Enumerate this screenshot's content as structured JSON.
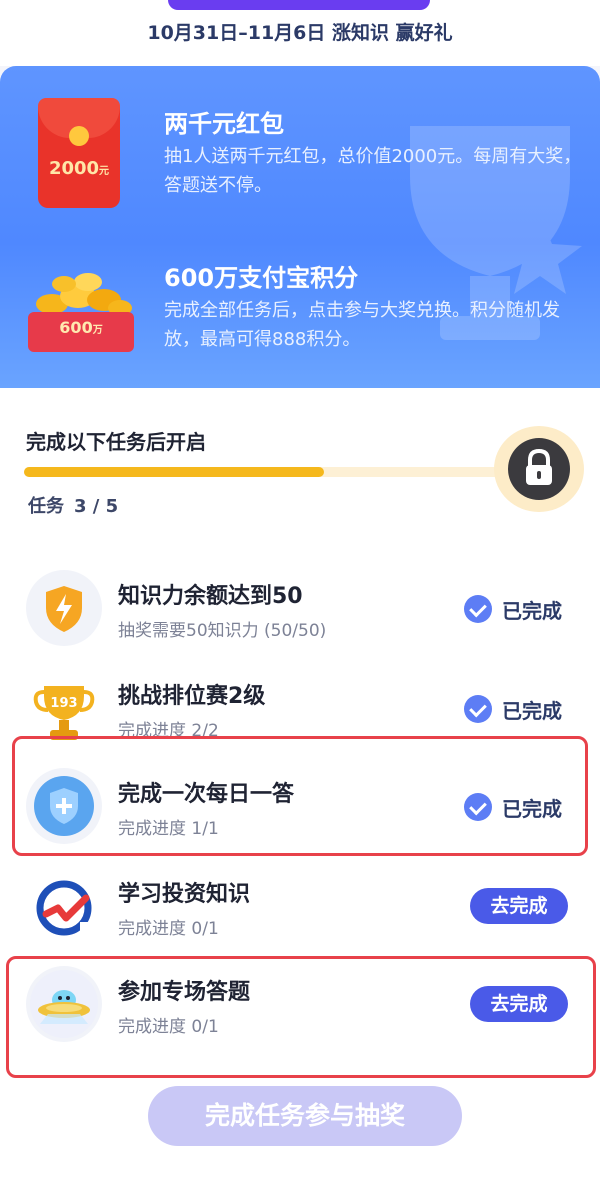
{
  "header": {
    "date_line": "10月31日–11月6日 涨知识 赢好礼"
  },
  "prizes": [
    {
      "title": "两千元红包",
      "desc": "抽1人送两千元红包，总价值2000元。每周有大奖，答题送不停。",
      "badge_amount": "2000",
      "badge_unit": "元",
      "icon": "red-envelope-icon"
    },
    {
      "title": "600万支付宝积分",
      "desc": "完成全部任务后，点击参与大奖兑换。积分随机发放，最高可得888积分。",
      "badge_amount": "600",
      "badge_unit": "万",
      "icon": "coin-box-icon"
    }
  ],
  "unlock": {
    "title": "完成以下任务后开启",
    "task_label": "任务",
    "progress_text": "3 / 5",
    "completed": 3,
    "total": 5,
    "progress_fraction": 0.6,
    "lock_icon": "lock-icon"
  },
  "tasks": [
    {
      "title": "知识力余额达到50",
      "subtitle": "抽奖需要50知识力 (50/50)",
      "status": "已完成",
      "state": "done",
      "icon": "shield-bolt-icon"
    },
    {
      "title": "挑战排位赛2级",
      "subtitle": "完成进度 2/2",
      "status": "已完成",
      "state": "done",
      "icon": "trophy-icon",
      "icon_text": "193"
    },
    {
      "title": "完成一次每日一答",
      "subtitle": "完成进度 1/1",
      "status": "已完成",
      "state": "done",
      "icon": "shield-plus-icon"
    },
    {
      "title": "学习投资知识",
      "subtitle": "完成进度 0/1",
      "status": "去完成",
      "state": "todo",
      "icon": "chart-check-icon"
    },
    {
      "title": "参加专场答题",
      "subtitle": "完成进度 0/1",
      "status": "去完成",
      "state": "todo",
      "icon": "ufo-icon"
    }
  ],
  "cta": {
    "label": "完成任务参与抽奖"
  },
  "colors": {
    "accent": "#4a5ae8",
    "progress": "#f5b81c",
    "highlight": "#e8414a",
    "panel": "#5f95ff"
  }
}
